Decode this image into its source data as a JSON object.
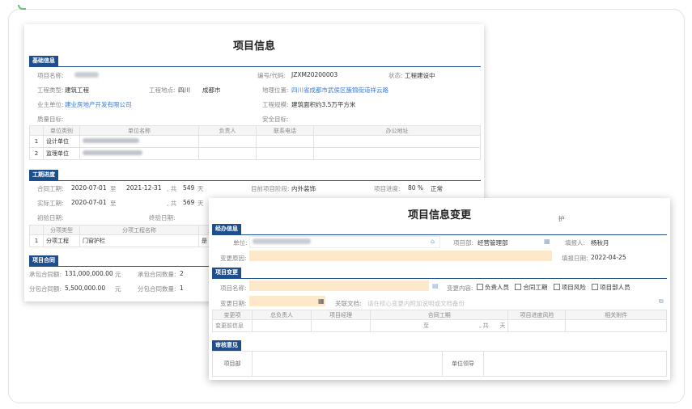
{
  "project_info": {
    "title": "项目信息",
    "basic": {
      "header": "基础信息",
      "name_label": "项目名称:",
      "code_label": "编号/代码:",
      "code_value": "JZXM20200003",
      "status_label": "状态:",
      "status_value": "工程建设中",
      "type_label": "工程类型:",
      "type_value": "建筑工程",
      "location_label": "工程地点:",
      "province": "四川",
      "city": "成都市",
      "geo_label": "地理位置:",
      "geo_value": "四川省成都市武侯区簇锦街道祥云路",
      "owner_label": "业主单位:",
      "owner_value": "建业房地产开发有限公司",
      "scale_label": "工程规模:",
      "scale_value": "建筑面积约3.5万平方米",
      "quality_label": "质量目标:",
      "safety_label": "安全目标:",
      "units_table": {
        "headers": [
          "单位类别",
          "单位名称",
          "负责人",
          "联系电话",
          "办公地址"
        ],
        "rows": [
          {
            "no": "1",
            "cat": "设计单位"
          },
          {
            "no": "2",
            "cat": "监理单位"
          }
        ]
      }
    },
    "schedule": {
      "header": "工期进度",
      "contract_label": "合同工期:",
      "contract_start": "2020-07-01",
      "to": "至",
      "contract_end": "2021-12-31",
      "total": ", 共",
      "contract_days": "549",
      "day_unit": "天",
      "stage_label": "目前项目阶段:",
      "stage_value": "内外装饰",
      "progress_label": "项目进度:",
      "progress_value": "80 %",
      "progress_status": "正常",
      "actual_label": "实际工期:",
      "actual_start": "2020-07-01",
      "actual_days": "569",
      "initial_label": "初验日期:",
      "final_label": "终验日期:",
      "sub_table": {
        "headers": [
          "分项类型",
          "分项工程名称",
          "是"
        ],
        "rows": [
          {
            "no": "1",
            "type": "分项工程",
            "name": "门窗护栏",
            "flag": "是"
          }
        ]
      }
    },
    "contract": {
      "header": "项目合同",
      "total_label": "承包合同额:",
      "total_value": "131,000,000.00",
      "yuan": "元",
      "count_label": "承包合同数量:",
      "count_value": "2",
      "sub_label": "分包合同额:",
      "sub_value": "5,500,000.00",
      "sub_count_label": "分包合同数量:",
      "sub_count_value": "1"
    }
  },
  "change_form": {
    "title": "项目信息变更",
    "corner_text": "护",
    "handling": {
      "header": "经办信息",
      "unit_label": "单位:",
      "dept_label": "项目部:",
      "dept_value": "经营管理部",
      "filler_label": "填报人:",
      "filler_value": "杨秋月",
      "reason_label": "变更原因:",
      "date_label": "填报日期:",
      "date_value": "2022-04-25"
    },
    "change": {
      "header": "项目变更",
      "proj_label": "项目名称:",
      "content_label": "变更内容:",
      "options": [
        "负责人员",
        "合同工期",
        "项目风险",
        "项目部人员"
      ],
      "change_date_label": "变更日期:",
      "related_label": "关联文档:",
      "related_placeholder": "请在核心变更内附加说明或文档备份",
      "table_headers": [
        "变更项",
        "总负责人",
        "项目经理",
        "合同工期",
        "项目进度风险",
        "相关附件"
      ],
      "row_label": "变更前信息",
      "row_to": "至",
      "row_total": ", 共",
      "row_day": "天"
    },
    "approval": {
      "header": "审核意见",
      "dept_label": "项目部",
      "leader_label": "单位领导"
    }
  }
}
